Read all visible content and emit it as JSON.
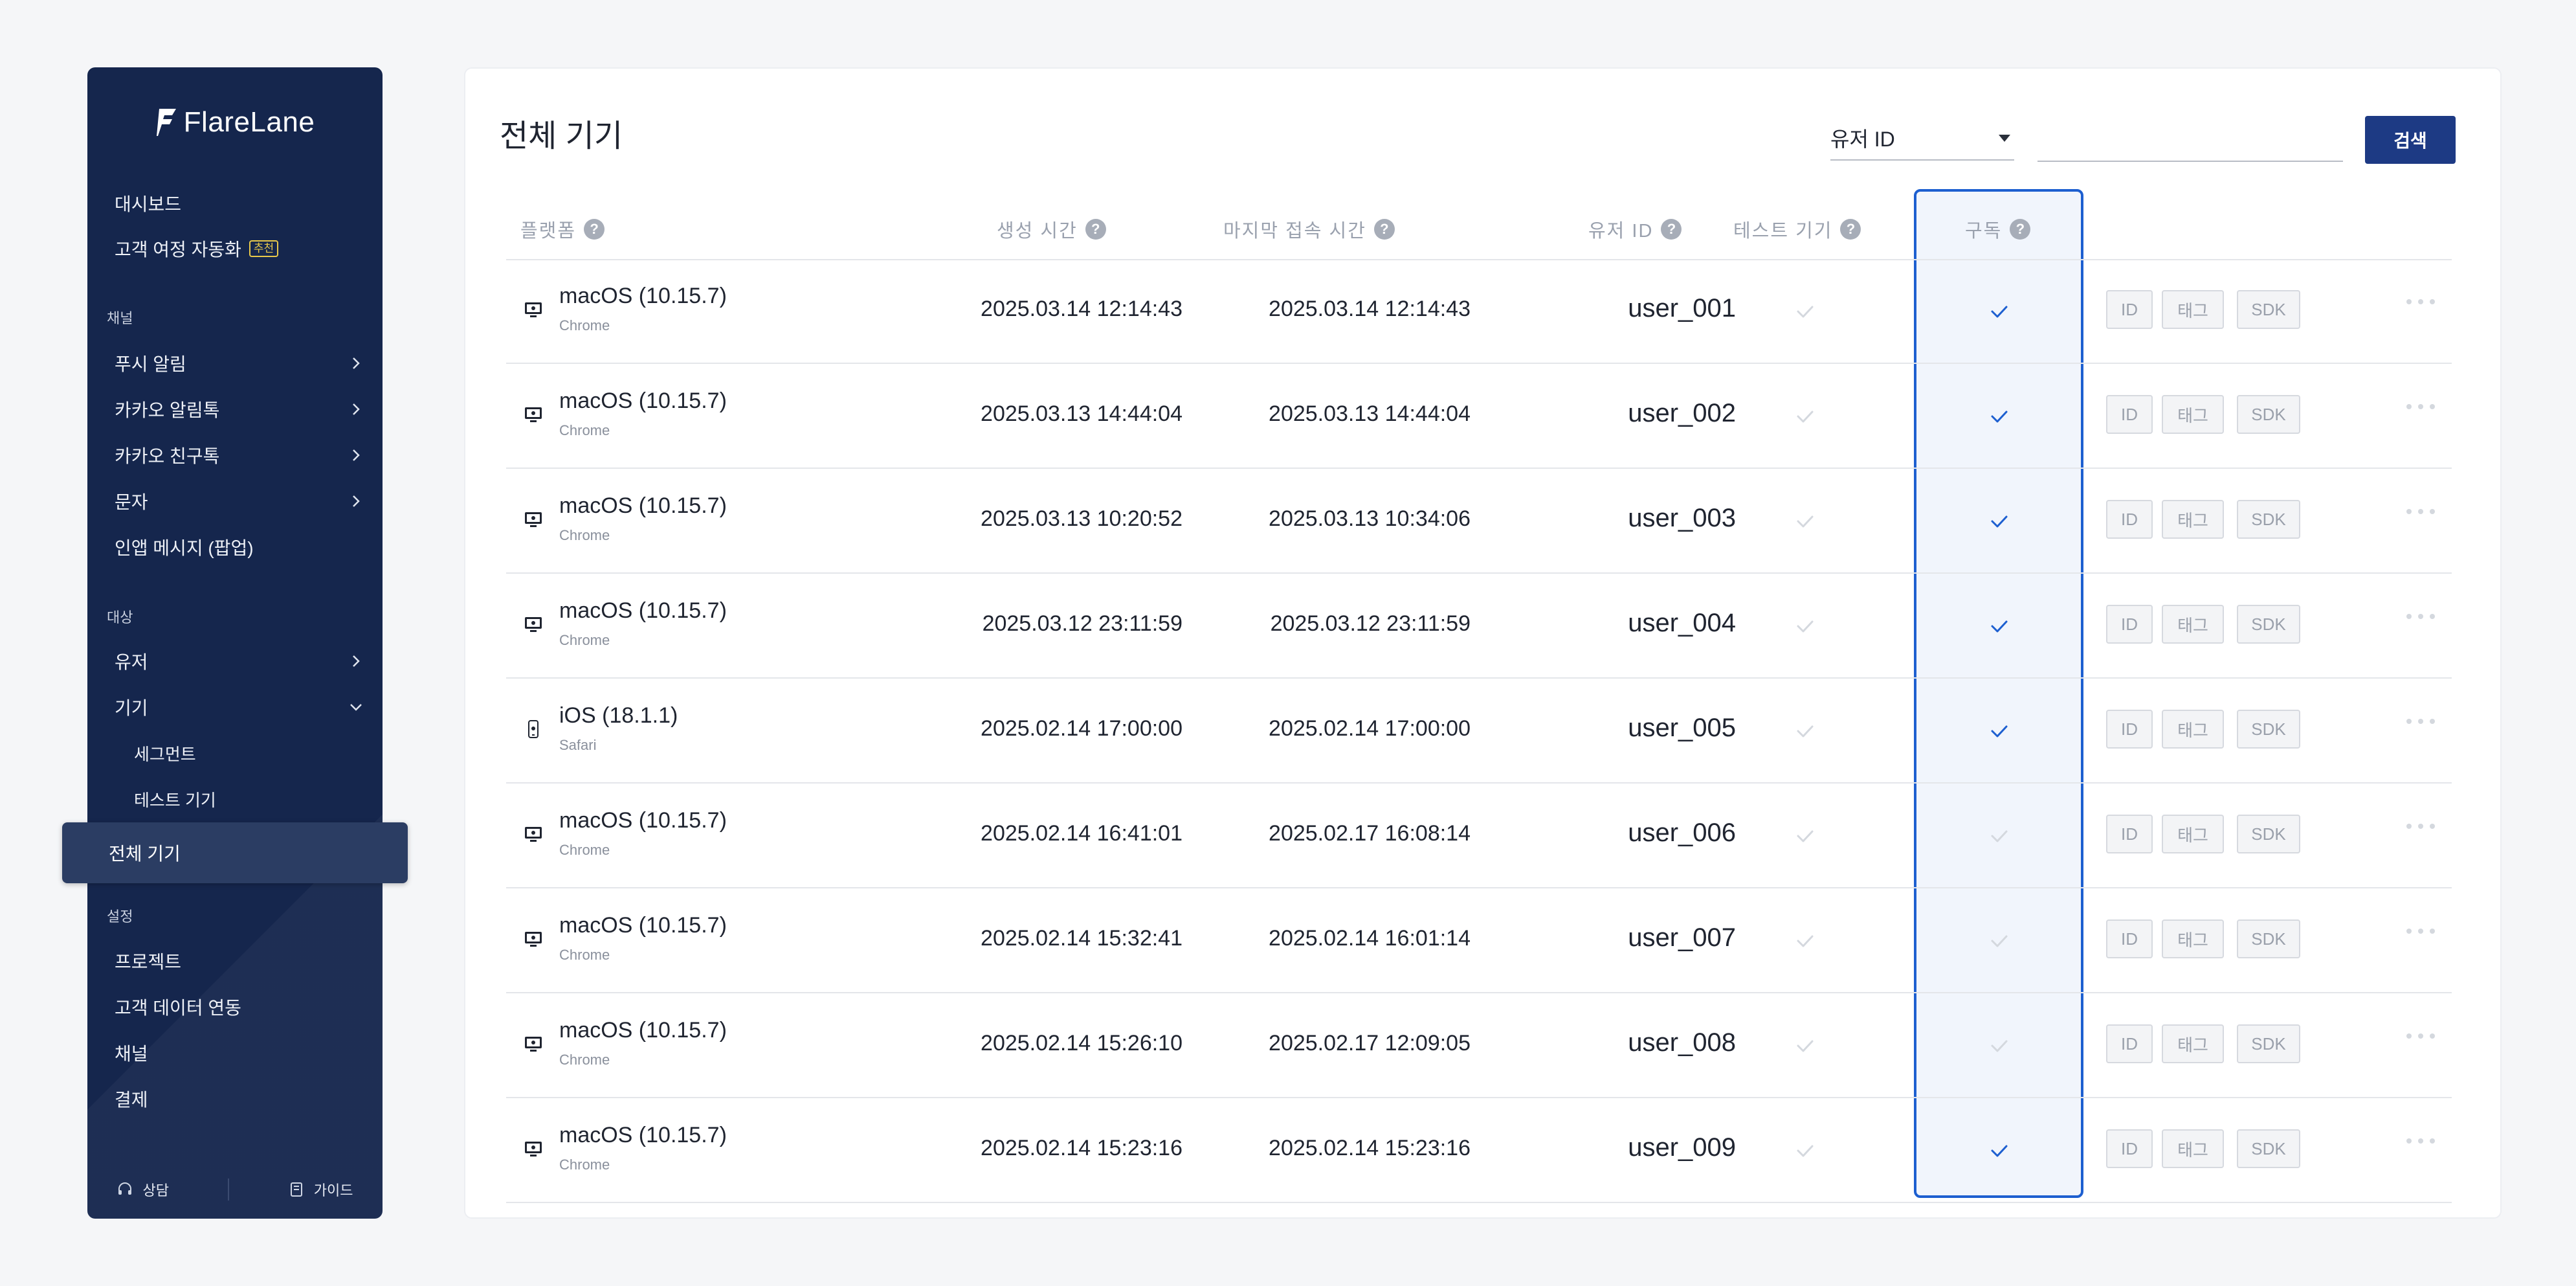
{
  "sidebar": {
    "logo_text": "FlareLane",
    "items": {
      "dashboard": "대시보드",
      "journey": "고객 여정 자동화",
      "journey_badge": "추천",
      "section_channel": "채널",
      "push": "푸시 알림",
      "kakao_alim": "카카오 알림톡",
      "kakao_friend": "카카오 친구톡",
      "sms": "문자",
      "inapp": "인앱 메시지 (팝업)",
      "section_target": "대상",
      "users": "유저",
      "devices": "기기",
      "segments": "세그먼트",
      "test_devices": "테스트 기기",
      "all_devices": "전체 기기",
      "section_settings": "설정",
      "project": "프로젝트",
      "data_integration": "고객 데이터 연동",
      "channel_settings": "채널",
      "billing": "결제"
    },
    "footer": {
      "consult": "상담",
      "guide": "가이드"
    },
    "accent_color": "#15264d"
  },
  "page": {
    "title": "전체 기기",
    "search": {
      "field": "유저 ID",
      "value": "",
      "button": "검색"
    }
  },
  "table": {
    "headers": {
      "platform": "플랫폼",
      "created": "생성 시간",
      "last_seen": "마지막 접속 시간",
      "user_id": "유저 ID",
      "test_device": "테스트 기기",
      "subscribed": "구독"
    },
    "buttons": {
      "id": "ID",
      "tag": "태그",
      "sdk": "SDK"
    },
    "rows": [
      {
        "platform": "macOS (10.15.7)",
        "browser": "Chrome",
        "created": "2025.03.14 12:14:43",
        "last_seen": "2025.03.14 12:14:43",
        "user_id": "user_001",
        "test": false,
        "subscribed": true,
        "icon": "desktop-icon"
      },
      {
        "platform": "macOS (10.15.7)",
        "browser": "Chrome",
        "created": "2025.03.13 14:44:04",
        "last_seen": "2025.03.13 14:44:04",
        "user_id": "user_002",
        "test": false,
        "subscribed": true,
        "icon": "desktop-icon"
      },
      {
        "platform": "macOS (10.15.7)",
        "browser": "Chrome",
        "created": "2025.03.13 10:20:52",
        "last_seen": "2025.03.13 10:34:06",
        "user_id": "user_003",
        "test": false,
        "subscribed": true,
        "icon": "desktop-icon"
      },
      {
        "platform": "macOS (10.15.7)",
        "browser": "Chrome",
        "created": "2025.03.12 23:11:59",
        "last_seen": "2025.03.12 23:11:59",
        "user_id": "user_004",
        "test": false,
        "subscribed": true,
        "icon": "desktop-icon"
      },
      {
        "platform": "iOS (18.1.1)",
        "browser": "Safari",
        "created": "2025.02.14 17:00:00",
        "last_seen": "2025.02.14 17:00:00",
        "user_id": "user_005",
        "test": false,
        "subscribed": true,
        "icon": "mobile-icon"
      },
      {
        "platform": "macOS (10.15.7)",
        "browser": "Chrome",
        "created": "2025.02.14 16:41:01",
        "last_seen": "2025.02.17 16:08:14",
        "user_id": "user_006",
        "test": false,
        "subscribed": false,
        "icon": "desktop-icon"
      },
      {
        "platform": "macOS (10.15.7)",
        "browser": "Chrome",
        "created": "2025.02.14 15:32:41",
        "last_seen": "2025.02.14 16:01:14",
        "user_id": "user_007",
        "test": false,
        "subscribed": false,
        "icon": "desktop-icon"
      },
      {
        "platform": "macOS (10.15.7)",
        "browser": "Chrome",
        "created": "2025.02.14 15:26:10",
        "last_seen": "2025.02.17 12:09:05",
        "user_id": "user_008",
        "test": false,
        "subscribed": false,
        "icon": "desktop-icon"
      },
      {
        "platform": "macOS (10.15.7)",
        "browser": "Chrome",
        "created": "2025.02.14 15:23:16",
        "last_seen": "2025.02.14 15:23:16",
        "user_id": "user_009",
        "test": false,
        "subscribed": true,
        "icon": "desktop-icon"
      }
    ]
  },
  "colors": {
    "checked": "#1d5fd0",
    "unchecked": "#d4d8de",
    "highlight_border": "#1d5fd0",
    "button_primary": "#1d3a84"
  }
}
